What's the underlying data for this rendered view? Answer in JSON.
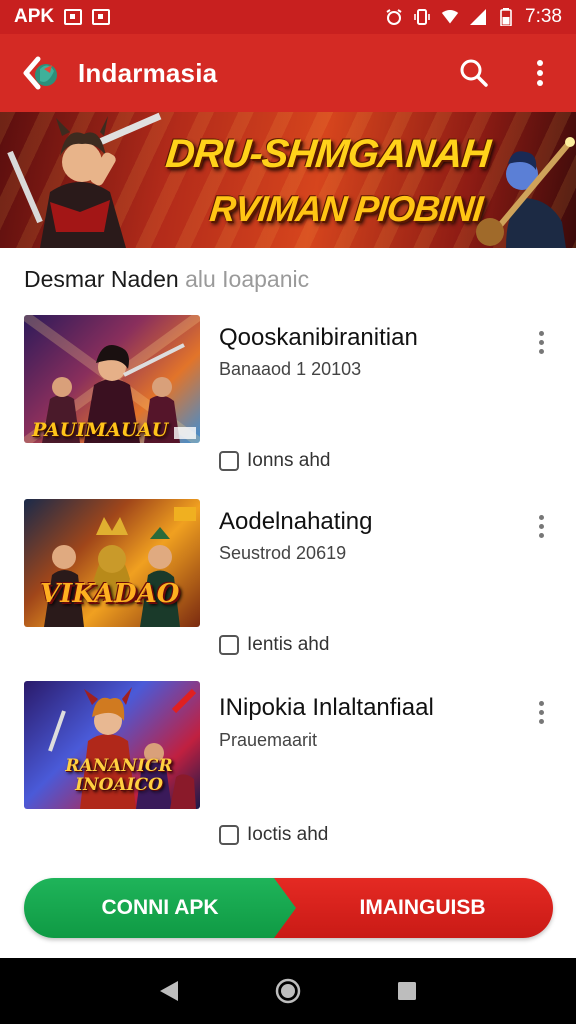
{
  "status_bar": {
    "left_label": "APK",
    "time": "7:38"
  },
  "app_bar": {
    "title": "Indarmasia"
  },
  "banner": {
    "line1": "DRU-SHMGANAH",
    "line2": "RVIMAN PIOBINI"
  },
  "section": {
    "title": "Desmar Naden",
    "title_faded": "alu Ioapanic"
  },
  "items": [
    {
      "title": "Qooskanibiranitian",
      "subtitle": "Banaaod 1 20103",
      "meta": "Ionns ahd",
      "thumb_text": "PAUIMAUAU"
    },
    {
      "title": "Aodelnahating",
      "subtitle": "Seustrod 20619",
      "meta": "Ientis ahd",
      "thumb_text": "VIKADAO"
    },
    {
      "title": "INipokia Inlaltanfiaal",
      "subtitle": "Prauemaarit",
      "meta": "Ioctis ahd",
      "thumb_text": "RANANICR INOAICO"
    }
  ],
  "actions": {
    "primary": "CONNI APK",
    "secondary": "IMAINGUISB"
  },
  "colors": {
    "appbar": "#d42a24",
    "statusbar": "#c8201f",
    "green": "#15a44c",
    "red": "#d8221d"
  }
}
